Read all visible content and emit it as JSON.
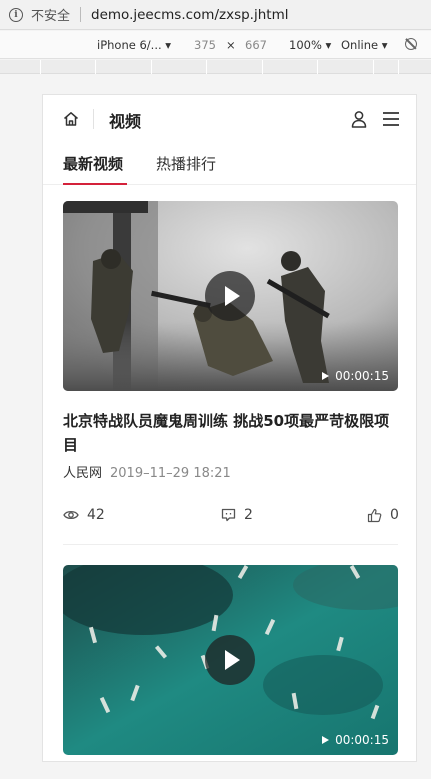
{
  "browser": {
    "security_label": "不安全",
    "url": "demo.jeecms.com/zxsp.jhtml"
  },
  "device_toolbar": {
    "device": "iPhone 6/...",
    "width": "375",
    "times": "×",
    "height": "667",
    "zoom": "100%",
    "network": "Online"
  },
  "header": {
    "title": "视频",
    "icons": [
      "home-icon",
      "user-icon",
      "menu-icon"
    ]
  },
  "tabs": [
    {
      "label": "最新视频",
      "active": true
    },
    {
      "label": "热播排行",
      "active": false
    }
  ],
  "accent_color": "#d4213a",
  "videos": [
    {
      "duration": "00:00:15",
      "title": "北京特战队员魔鬼周训练 挑战50项最严苛极限项目",
      "source": "人民网",
      "date": "2019–11–29 18:21",
      "views": "42",
      "comments": "2",
      "likes": "0"
    },
    {
      "duration": "00:00:15"
    }
  ]
}
